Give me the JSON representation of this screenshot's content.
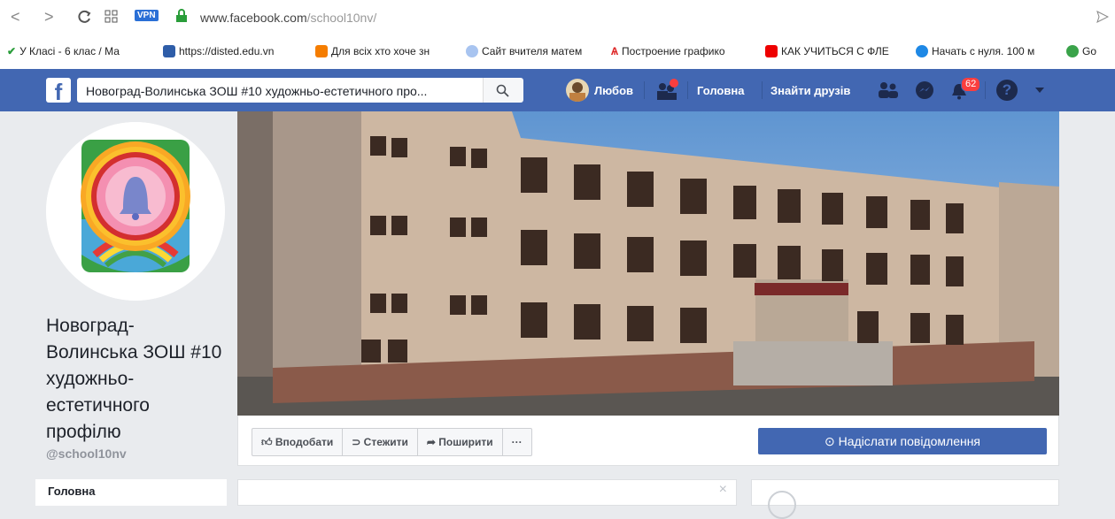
{
  "browser": {
    "url_host": "www.facebook.com",
    "url_path": "/school10nv/",
    "vpn_label": "VPN",
    "bookmarks": [
      {
        "label": "У Класі - 6 клас / Ма",
        "icon": "check-icon"
      },
      {
        "label": "https://disted.edu.vn",
        "icon": "grid-icon"
      },
      {
        "label": "Для всіх хто хоче зн",
        "icon": "blogger-icon"
      },
      {
        "label": "Сайт вчителя матем",
        "icon": "site-icon"
      },
      {
        "label": "Построение графико",
        "icon": "graph-icon"
      },
      {
        "label": "КАК УЧИТЬСЯ С ФЛЕ",
        "icon": "youtube-icon"
      },
      {
        "label": "Начать с нуля. 100 м",
        "icon": "globe-icon"
      },
      {
        "label": "Go",
        "icon": "chat-icon"
      }
    ]
  },
  "fb": {
    "search_value": "Новоград-Волинська ЗОШ #10 художньо-естетичного про...",
    "user_name": "Любов",
    "home_label": "Головна",
    "find_friends_label": "Знайти друзів",
    "notifications_count": "62",
    "brand_color": "#4267b2"
  },
  "page": {
    "name": "Новоград-Волинська ЗОШ #10 художньо-естетичного профілю",
    "handle": "@school10nv",
    "sidebar_home": "Головна",
    "actions": {
      "like": "Вподобати",
      "follow": "Стежити",
      "share": "Поширити",
      "more": "···",
      "message": "Надіслати повідомлення"
    },
    "close_glyph": "×"
  }
}
